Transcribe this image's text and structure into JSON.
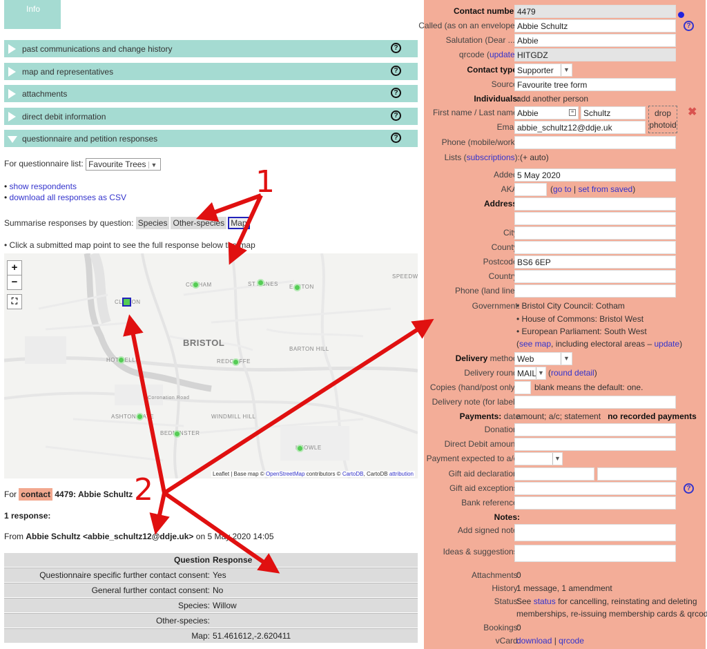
{
  "left": {
    "info_tab": "Info",
    "accordions": [
      {
        "label": "past communications and change history"
      },
      {
        "label": "map and representatives"
      },
      {
        "label": "attachments"
      },
      {
        "label": "direct debit information"
      },
      {
        "label": "questionnaire and petition responses"
      }
    ],
    "help_glyph": "?",
    "questionnaire_label": "For questionnaire list:",
    "questionnaire_value": "Favourite Trees",
    "show_respondents": "show respondents",
    "download_csv": "download all responses as CSV",
    "summarise_label": "Summarise responses by question:",
    "summarise_buttons": [
      "Species",
      "Other-species",
      "Map"
    ],
    "click_note": "Click a submitted map point to see the full response below the map",
    "map": {
      "zoom_in": "+",
      "zoom_out": "−",
      "fullscreen": "⛶",
      "labels": [
        "COTHAM",
        "ST AGNES",
        "EASTON",
        "CLIFTON",
        "BRISTOL",
        "BARTON HILL",
        "HOTWELLS",
        "REDCLIFFE",
        "ASHTON GATE",
        "WINDMILL HILL",
        "BEDMINSTER",
        "KNOWLE",
        "SPEEDWELL",
        "Coronation Road"
      ],
      "attribution_pre": "Leaflet | Base map ©",
      "attribution_osm": "OpenStreetMap",
      "attribution_mid": "contributors ©",
      "attribution_carto": "CartoDB",
      "attribution_post": ", CartoDB",
      "attribution_link": "attribution"
    },
    "for_prefix": "For",
    "contact_tag": "contact",
    "for_rest": "4479: Abbie Schultz",
    "response_count": "1 response:",
    "from_prefix": "From",
    "from_name": "Abbie Schultz <abbie_schultz12@ddje.uk>",
    "from_suffix": "on 5 May 2020 14:05",
    "table": {
      "head_question": "Question",
      "head_response": "Response",
      "rows": [
        {
          "q": "Questionnaire specific further contact consent:",
          "a": "Yes"
        },
        {
          "q": "General further contact consent:",
          "a": "No"
        },
        {
          "q": "Species:",
          "a": "Willow"
        },
        {
          "q": "Other-species:",
          "a": ""
        },
        {
          "q": "Map:",
          "a": "51.461612,-2.620411"
        }
      ]
    }
  },
  "right": {
    "contact_number_label": "Contact number:",
    "contact_number": "4479",
    "called_label": "Called (as on an envelope):",
    "called": "Abbie Schultz",
    "salutation_label": "Salutation (Dear ...):",
    "salutation": "Abbie",
    "qrcode_label": "qrcode",
    "qrcode_update": "update",
    "qrcode": "HITGDZ",
    "contact_type_label": "Contact type:",
    "contact_type": "Supporter",
    "source_label": "Source:",
    "source": "Favourite tree form",
    "individuals_label": "Individuals:",
    "add_person": "add another person",
    "name_label": "First name / Last name:",
    "first_name": "Abbie",
    "last_name": "Schultz",
    "email_label": "Email:",
    "email": "abbie_schultz12@ddje.uk",
    "photo_drop": "drop photoid",
    "phone_mobile_label": "Phone (mobile/work):",
    "lists_label": "Lists",
    "lists_subscriptions": "subscriptions",
    "lists_auto": "(+ auto)",
    "added_label": "Added:",
    "added": "5 May 2020",
    "aka_label": "AKA:",
    "aka_goto": "go to",
    "aka_setfrom": "set from saved",
    "address_label": "Address:",
    "city_label": "City:",
    "county_label": "County:",
    "postcode_label": "Postcode:",
    "postcode": "BS6 6EP",
    "country_label": "Country:",
    "phone_land_label": "Phone (land line):",
    "government_label": "Government:",
    "government": [
      "Bristol City Council: Cotham",
      "House of Commons: Bristol West",
      "European Parliament: South West"
    ],
    "gov_see_map": "see map",
    "gov_including": ", including electoral areas –",
    "gov_update": "update",
    "delivery_method_label_b": "Delivery",
    "delivery_method_label": "method:",
    "delivery_method": "Web",
    "delivery_round_label": "Delivery round:",
    "delivery_round": "MAIL",
    "round_detail": "round detail",
    "copies_label": "Copies (hand/post only):",
    "copies_note": "blank means the default: one.",
    "delivery_note_label": "Delivery note (for label):",
    "payments_label_b": "Payments:",
    "payments_label": "date",
    "payments_cols": "amount; a/c; statement",
    "no_payments": "no recorded payments",
    "donation_label": "Donation:",
    "dd_amount_label": "Direct Debit amount:",
    "payment_ac_label": "Payment expected to a/c:",
    "gift_aid_label": "Gift aid declaration:",
    "gift_aid_exc_label": "Gift aid exceptions:",
    "bank_ref_label": "Bank reference:",
    "notes_label": "Notes:",
    "signed_note_label": "Add signed note:",
    "ideas_label": "Ideas & suggestions:",
    "attachments_label": "Attachments:",
    "attachments": "0",
    "history_label": "History:",
    "history": "1 message, 1 amendment",
    "status_label": "Status:",
    "status_pre": "See",
    "status_link": "status",
    "status_post": "for cancelling, reinstating and deleting",
    "status_line2": "memberships, re-issuing membership cards & qrcodes",
    "bookings_label": "Bookings:",
    "bookings": "0",
    "vcard_label": "vCard:",
    "vcard_download": "download",
    "vcard_qrcode": "qrcode"
  },
  "annotations": {
    "one": "1",
    "two": "2",
    "arrow_color": "#e01010"
  },
  "colors": {
    "accordion": "#a5dbd2",
    "panel": "#f3ad98",
    "link": "#3333cc",
    "pin": "#55cc55"
  }
}
